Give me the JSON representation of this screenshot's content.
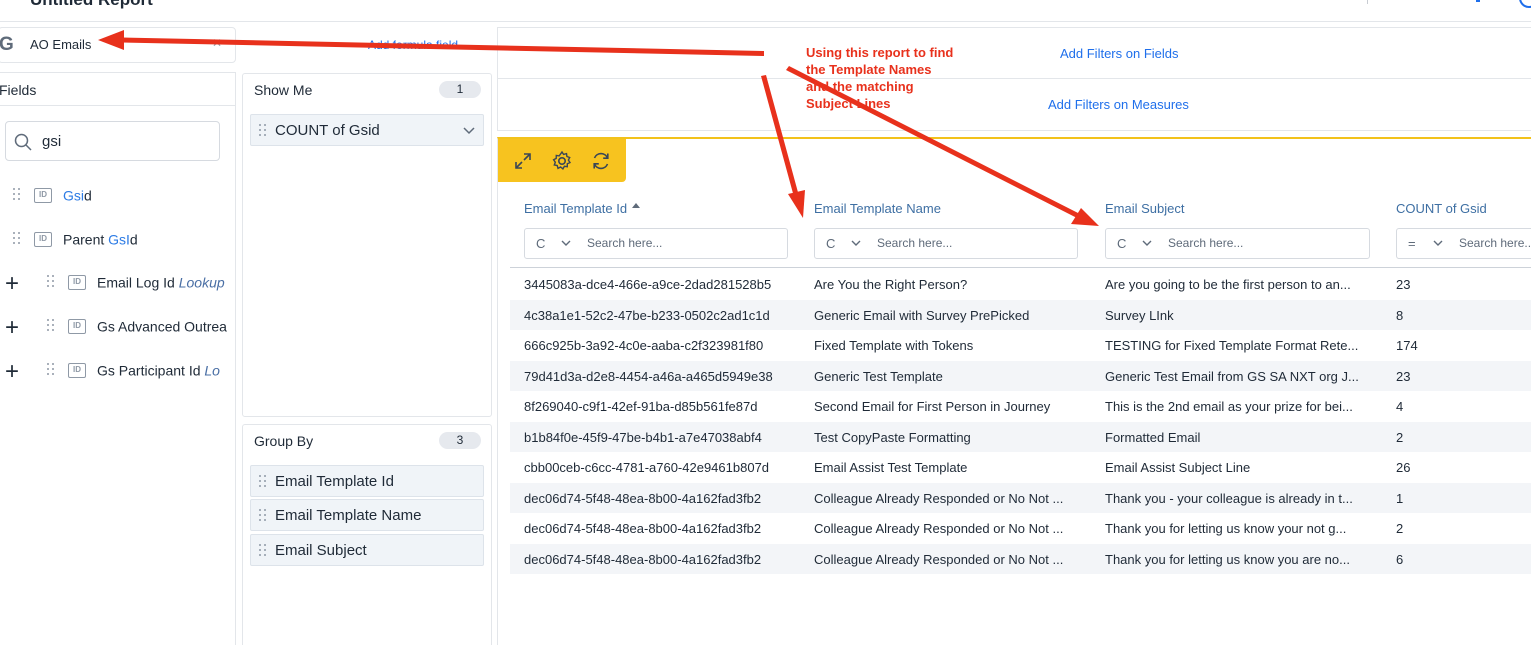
{
  "header": {
    "title": "Untitled Report"
  },
  "source": {
    "icon": "google-g-icon",
    "name": "AO Emails",
    "formula_link": "Add formula field"
  },
  "fields_panel": {
    "title": "Fields",
    "search_value": "gsi",
    "items": [
      {
        "pre": "",
        "hl": "Gsi",
        "post": "d",
        "lookup": "",
        "expandable": false
      },
      {
        "pre": "Parent ",
        "hl": "GsI",
        "post": "d",
        "lookup": "",
        "expandable": false
      },
      {
        "pre": "Email Log Id ",
        "hl": "",
        "post": "",
        "lookup": "Lookup",
        "expandable": true
      },
      {
        "pre": "Gs Advanced Outrea",
        "hl": "",
        "post": "",
        "lookup": "",
        "expandable": true
      },
      {
        "pre": "Gs Participant Id ",
        "hl": "",
        "post": "",
        "lookup": "Lo",
        "expandable": true
      }
    ]
  },
  "show_me": {
    "title": "Show Me",
    "count": "1",
    "items": [
      "COUNT of Gsid"
    ]
  },
  "group_by": {
    "title": "Group By",
    "count": "3",
    "items": [
      "Email Template Id",
      "Email Template Name",
      "Email Subject"
    ]
  },
  "filters": {
    "fields_link": "Add Filters on Fields",
    "measures_link": "Add Filters on Measures"
  },
  "toolbar": {
    "icons": [
      "expand-icon",
      "settings-icon",
      "refresh-icon"
    ]
  },
  "table": {
    "columns": [
      {
        "label": "Email Template Id",
        "op": "C",
        "placeholder": "Search here...",
        "sorted": "ascending"
      },
      {
        "label": "Email Template Name",
        "op": "C",
        "placeholder": "Search here..."
      },
      {
        "label": "Email Subject",
        "op": "C",
        "placeholder": "Search here..."
      },
      {
        "label": "COUNT of Gsid",
        "op": "=",
        "placeholder": "Search here..."
      }
    ],
    "rows": [
      [
        "3445083a-dce4-466e-a9ce-2dad281528b5",
        "Are You the Right Person?",
        "Are you going to be the first person to an...",
        "23"
      ],
      [
        "4c38a1e1-52c2-47be-b233-0502c2ad1c1d",
        "Generic Email with Survey PrePicked",
        "Survey LInk",
        "8"
      ],
      [
        "666c925b-3a92-4c0e-aaba-c2f323981f80",
        "Fixed Template with Tokens",
        "TESTING for Fixed Template Format Rete...",
        "174"
      ],
      [
        "79d41d3a-d2e8-4454-a46a-a465d5949e38",
        "Generic Test Template",
        "Generic Test Email from GS SA NXT org J...",
        "23"
      ],
      [
        "8f269040-c9f1-42ef-91ba-d85b561fe87d",
        "Second Email for First Person in Journey",
        "This is the 2nd email as your prize for bei...",
        "4"
      ],
      [
        "b1b84f0e-45f9-47be-b4b1-a7e47038abf4",
        "Test CopyPaste Formatting",
        "Formatted Email",
        "2"
      ],
      [
        "cbb00ceb-c6cc-4781-a760-42e9461b807d",
        "Email Assist Test Template",
        "Email Assist Subject Line",
        "26"
      ],
      [
        "dec06d74-5f48-48ea-8b00-4a162fad3fb2",
        "Colleague Already Responded or No Not ...",
        "Thank you - your colleague is already in t...",
        "1"
      ],
      [
        "dec06d74-5f48-48ea-8b00-4a162fad3fb2",
        "Colleague Already Responded or No Not ...",
        "Thank you for letting us know your not g...",
        "2"
      ],
      [
        "dec06d74-5f48-48ea-8b00-4a162fad3fb2",
        "Colleague Already Responded or No Not ...",
        "Thank you for letting us know you are no...",
        "6"
      ]
    ]
  },
  "annotation": {
    "text": "Using this report to find the Template Names and the matching Subject Lines",
    "color": "#e8311c"
  }
}
